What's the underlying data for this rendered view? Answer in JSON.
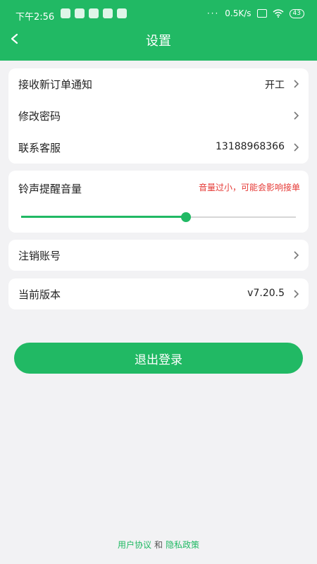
{
  "status": {
    "time": "下午2:56",
    "dots": "···",
    "speed": "0.5K/s",
    "battery": "43"
  },
  "header": {
    "title": "设置",
    "back_icon": "back-arrow-icon"
  },
  "settings_group": [
    {
      "label": "接收新订单通知",
      "value": "开工"
    },
    {
      "label": "修改密码",
      "value": ""
    },
    {
      "label": "联系客服",
      "value": "13188968366"
    }
  ],
  "volume": {
    "title": "铃声提醒音量",
    "warning": "音量过小，可能会影响接单",
    "level_fraction": 0.6
  },
  "cancel_account": {
    "label": "注销账号"
  },
  "version": {
    "label": "当前版本",
    "value": "v7.20.5"
  },
  "logout": {
    "label": "退出登录"
  },
  "footer": {
    "user_agreement": "用户协议",
    "and": "和",
    "privacy_policy": "隐私政策"
  },
  "colors": {
    "accent": "#21b964",
    "warning": "#e53935",
    "background": "#f2f2f4"
  }
}
